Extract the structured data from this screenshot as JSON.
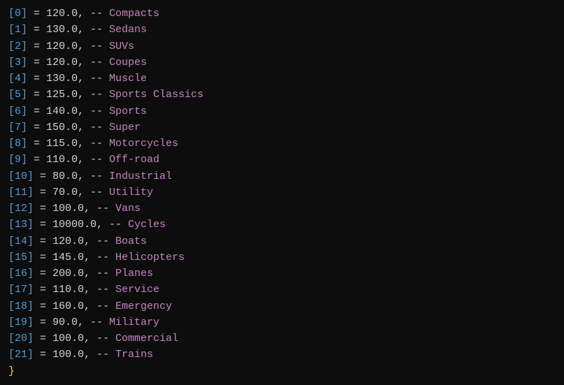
{
  "lines": [
    {
      "index": "0",
      "value": "120.0",
      "name": "Compacts"
    },
    {
      "index": "1",
      "value": "130.0",
      "name": "Sedans"
    },
    {
      "index": "2",
      "value": "120.0",
      "name": "SUVs"
    },
    {
      "index": "3",
      "value": "120.0",
      "name": "Coupes"
    },
    {
      "index": "4",
      "value": "130.0",
      "name": "Muscle"
    },
    {
      "index": "5",
      "value": "125.0",
      "name": "Sports Classics"
    },
    {
      "index": "6",
      "value": "140.0",
      "name": "Sports"
    },
    {
      "index": "7",
      "value": "150.0",
      "name": "Super"
    },
    {
      "index": "8",
      "value": "115.0",
      "name": "Motorcycles"
    },
    {
      "index": "9",
      "value": "110.0",
      "name": "Off-road"
    },
    {
      "index": "10",
      "value": "80.0",
      "name": "Industrial"
    },
    {
      "index": "11",
      "value": "70.0",
      "name": "Utility"
    },
    {
      "index": "12",
      "value": "100.0",
      "name": "Vans"
    },
    {
      "index": "13",
      "value": "10000.0",
      "name": "Cycles"
    },
    {
      "index": "14",
      "value": "120.0",
      "name": "Boats"
    },
    {
      "index": "15",
      "value": "145.0",
      "name": "Helicopters"
    },
    {
      "index": "16",
      "value": "200.0",
      "name": "Planes"
    },
    {
      "index": "17",
      "value": "110.0",
      "name": "Service"
    },
    {
      "index": "18",
      "value": "160.0",
      "name": "Emergency"
    },
    {
      "index": "19",
      "value": "90.0",
      "name": "Military"
    },
    {
      "index": "20",
      "value": "100.0",
      "name": "Commercial"
    },
    {
      "index": "21",
      "value": "100.0",
      "name": "Trains"
    }
  ],
  "closing_brace": "}"
}
